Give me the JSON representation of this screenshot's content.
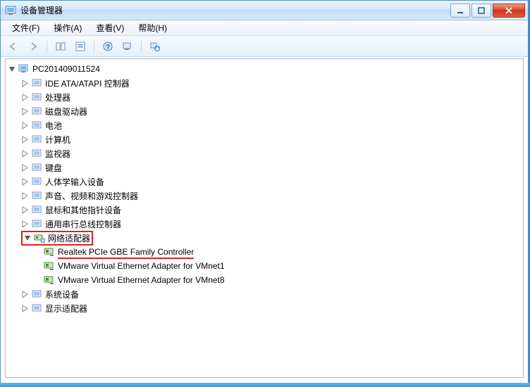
{
  "window": {
    "title": "设备管理器"
  },
  "menu": {
    "file": "文件(F)",
    "action": "操作(A)",
    "view": "查看(V)",
    "help": "帮助(H)"
  },
  "tree": {
    "root": "PC201409011524",
    "items": [
      {
        "label": "IDE ATA/ATAPI 控制器"
      },
      {
        "label": "处理器"
      },
      {
        "label": "磁盘驱动器"
      },
      {
        "label": "电池"
      },
      {
        "label": "计算机"
      },
      {
        "label": "监视器"
      },
      {
        "label": "键盘"
      },
      {
        "label": "人体学输入设备"
      },
      {
        "label": "声音、视频和游戏控制器"
      },
      {
        "label": "鼠标和其他指针设备"
      },
      {
        "label": "通用串行总线控制器"
      },
      {
        "label": "网络适配器",
        "highlight": true,
        "expanded": true,
        "children": [
          {
            "label": "Realtek PCIe GBE Family Controller",
            "underline": true
          },
          {
            "label": "VMware Virtual Ethernet Adapter for VMnet1"
          },
          {
            "label": "VMware Virtual Ethernet Adapter for VMnet8"
          }
        ]
      },
      {
        "label": "系统设备"
      },
      {
        "label": "显示适配器"
      }
    ]
  }
}
